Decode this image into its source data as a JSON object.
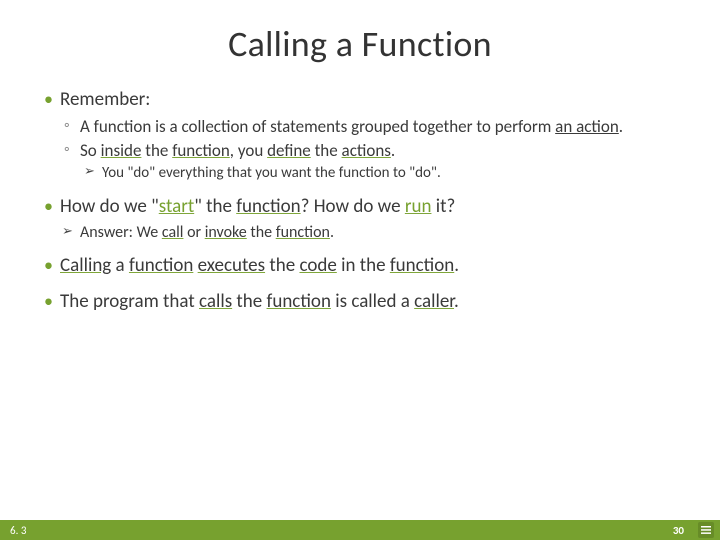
{
  "title": "Calling a Function",
  "b1": "Remember:",
  "b1_s1_a": "A function is a collection of statements grouped together to perform ",
  "b1_s1_b": "an action",
  "b1_s1_c": ".",
  "b1_s2_a": "So ",
  "b1_s2_b": "inside",
  "b1_s2_c": " the ",
  "b1_s2_d": "function",
  "b1_s2_e": ", you ",
  "b1_s2_f": "define",
  "b1_s2_g": " the ",
  "b1_s2_h": "actions",
  "b1_s2_i": ".",
  "b1_s2_sub": "You \"do\" everything that you want the function to \"do\".",
  "b2_a": "How do we \"",
  "b2_b": "start",
  "b2_c": "\" the ",
  "b2_d": "function",
  "b2_e": "? How do we ",
  "b2_f": "run",
  "b2_g": " it?",
  "b2_sub_a": "Answer: We ",
  "b2_sub_b": "call",
  "b2_sub_c": " or ",
  "b2_sub_d": "invoke",
  "b2_sub_e": " the ",
  "b2_sub_f": "function",
  "b2_sub_g": ".",
  "b3_a": "Calling",
  "b3_b": " a ",
  "b3_c": "function",
  "b3_d": " ",
  "b3_e": "executes",
  "b3_f": " the ",
  "b3_g": "code",
  "b3_h": " in the ",
  "b3_i": "function",
  "b3_j": ".",
  "b4_a": "The program that ",
  "b4_b": "calls",
  "b4_c": " the ",
  "b4_d": "function",
  "b4_e": " is called a ",
  "b4_f": "caller",
  "b4_g": ".",
  "footer_left": "6. 3",
  "footer_page": "30"
}
